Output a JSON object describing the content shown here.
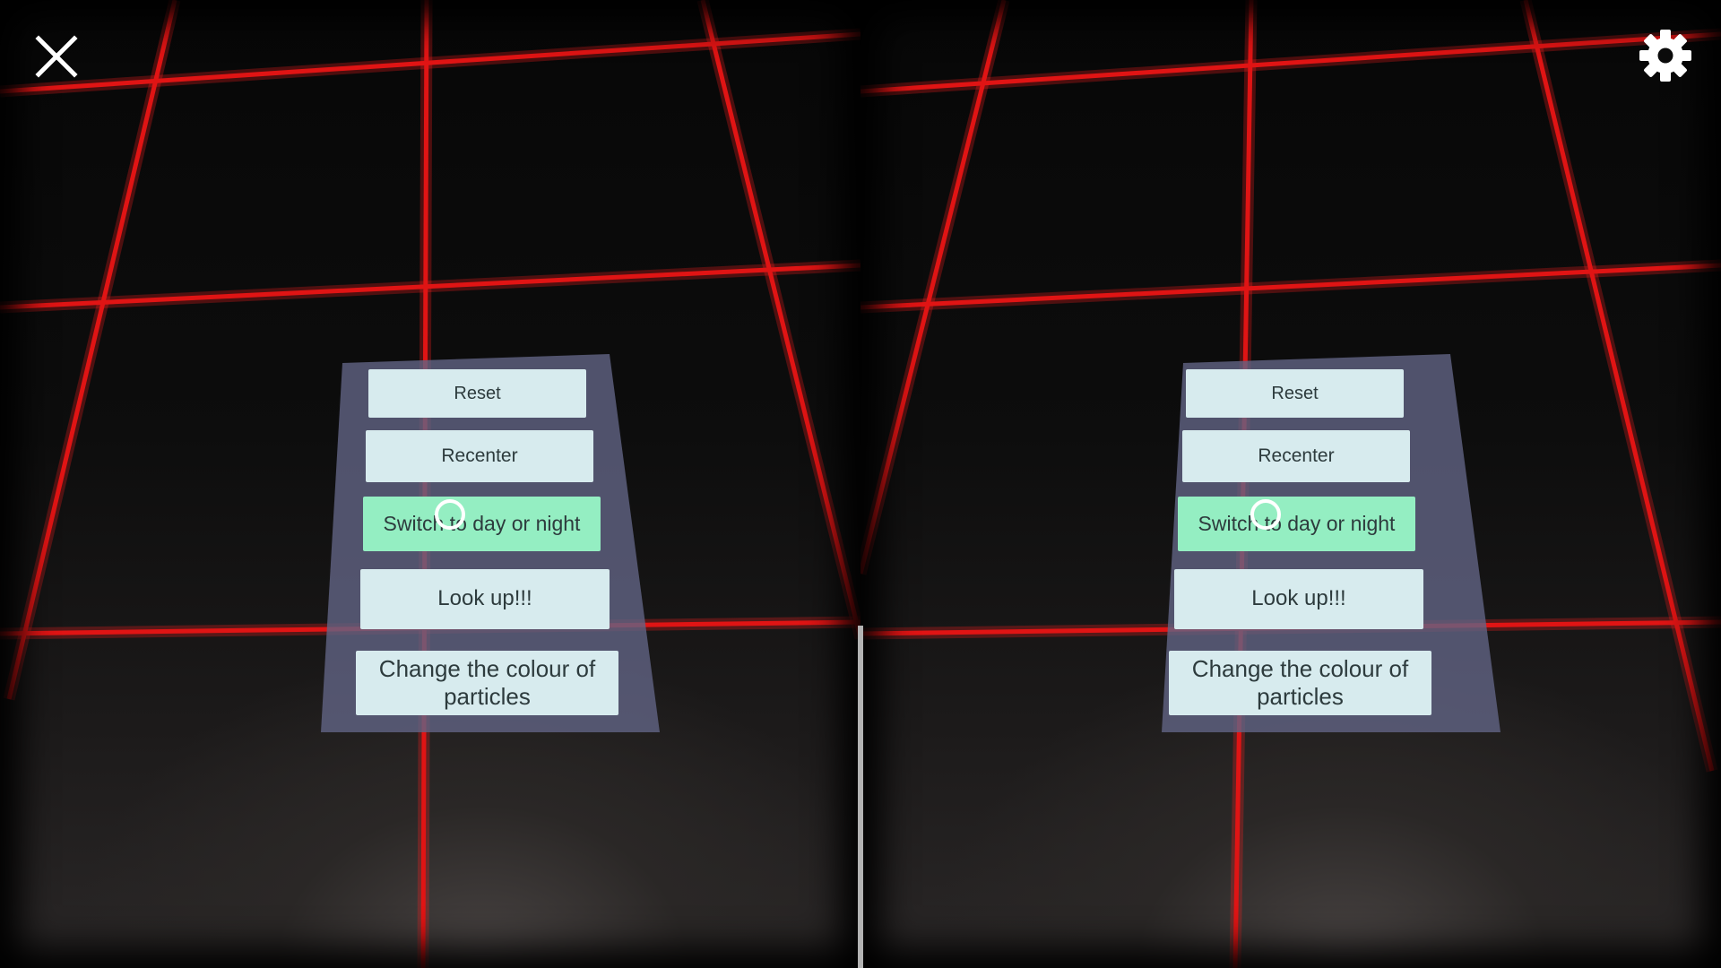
{
  "menu": {
    "reset_label": "Reset",
    "recenter_label": "Recenter",
    "switch_label": "Switch to day or night",
    "look_label": "Look up!!!",
    "change_label": "Change the colour of particles"
  },
  "icons": {
    "close": "close-icon",
    "settings": "gear-icon"
  },
  "colors": {
    "grid": "#e01414",
    "button": "#d7ebee",
    "button_highlight": "#94eec2",
    "panel": "#626484"
  }
}
